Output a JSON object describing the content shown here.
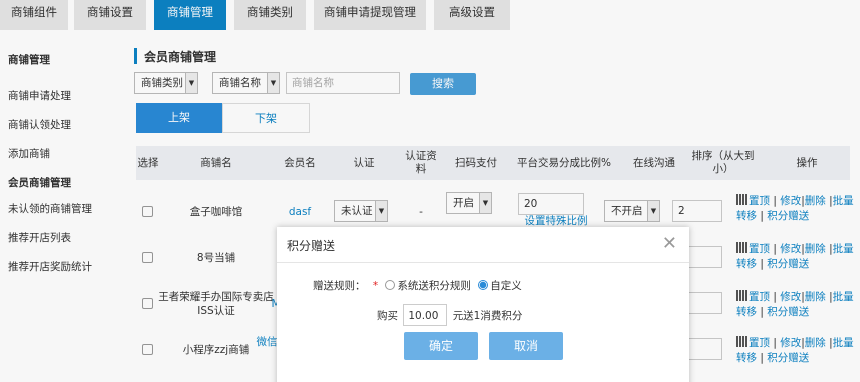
{
  "nav": {
    "tabs": [
      {
        "label": "商铺组件",
        "active": false
      },
      {
        "label": "商铺设置",
        "active": false
      },
      {
        "label": "商铺管理",
        "active": true
      },
      {
        "label": "商铺类别",
        "active": false
      },
      {
        "label": "商铺申请提现管理",
        "active": false
      },
      {
        "label": "高级设置",
        "active": false
      }
    ]
  },
  "sidebar": {
    "items": [
      {
        "label": "商铺管理",
        "bold": true
      },
      {
        "label": "商铺申请处理",
        "bold": false
      },
      {
        "label": "商铺认领处理",
        "bold": false
      },
      {
        "label": "添加商铺",
        "bold": false
      },
      {
        "label": "会员商铺管理",
        "bold": true
      },
      {
        "label": "未认领的商铺管理",
        "bold": false
      },
      {
        "label": "推荐开店列表",
        "bold": false
      },
      {
        "label": "推荐开店奖励统计",
        "bold": false
      }
    ]
  },
  "main": {
    "title": "会员商铺管理",
    "filter": {
      "category": "商铺类别",
      "field": "商铺名称",
      "search_placeholder": "商铺名称",
      "search_button": "搜索"
    },
    "toggle": {
      "on": "上架",
      "off": "下架"
    },
    "table": {
      "headers": [
        "选择",
        "商铺名",
        "会员名",
        "认证",
        "认证资料",
        "扫码支付",
        "平台交易分成比例%",
        "在线沟通",
        "排序（从大到小）",
        "操作"
      ],
      "rows": [
        {
          "shop": "盒子咖啡馆",
          "member": "dasf",
          "auth": "未认证",
          "auth_data": "-",
          "scan_pay": "开启",
          "ratio": "20",
          "ratio_link": "设置特殊比例",
          "chat": "不开启",
          "sort": "2"
        },
        {
          "shop": "8号当铺",
          "member": "",
          "auth": "",
          "auth_data": "",
          "scan_pay": "",
          "ratio": "",
          "ratio_link": "",
          "chat": "",
          "sort": ""
        },
        {
          "shop": "王者荣耀手办国际专卖店ISS认证",
          "member": "M",
          "auth": "",
          "auth_data": "",
          "scan_pay": "",
          "ratio": "",
          "ratio_link": "",
          "chat": "",
          "sort": ""
        },
        {
          "shop": "小程序zzj商铺",
          "member": "微信",
          "auth": "",
          "auth_data": "",
          "scan_pay": "",
          "ratio": "",
          "ratio_link": "",
          "chat": "",
          "sort": ""
        }
      ],
      "ops": {
        "top": "置顶",
        "edit": "修改",
        "delete": "删除",
        "batch": "批量转移",
        "gift": "积分赠送",
        "sep": "|"
      }
    }
  },
  "modal": {
    "title": "积分赠送",
    "rule_label": "赠送规则：",
    "required_mark": "*",
    "option_system": "系统送积分规则",
    "option_custom": "自定义",
    "selected": "custom",
    "buy_prefix": "购买",
    "amount": "10.00",
    "buy_suffix": "元送1消费积分",
    "confirm": "确定",
    "cancel": "取消"
  },
  "colors": {
    "accent": "#0d84c6",
    "button": "#6bb0e6",
    "required": "#e02020"
  }
}
